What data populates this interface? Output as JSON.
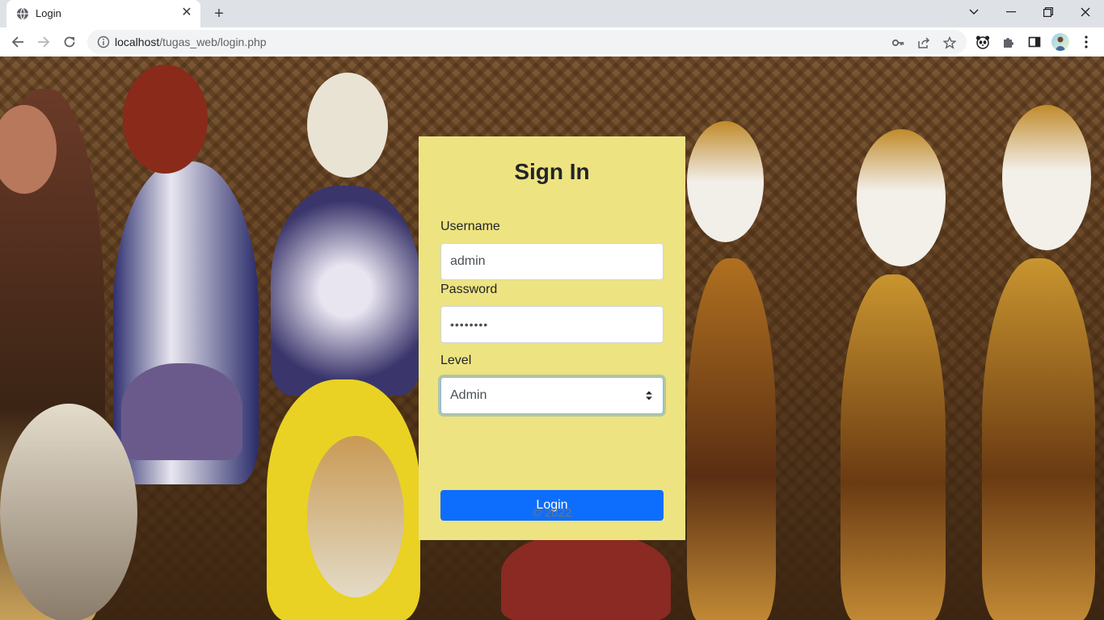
{
  "browser": {
    "tab_title": "Login",
    "url_host": "localhost",
    "url_path": "/tugas_web/login.php"
  },
  "card": {
    "title": "Sign In",
    "username_label": "Username",
    "username_value": "admin",
    "password_label": "Password",
    "password_value": "••••••••",
    "level_label": "Level",
    "level_selected": "Admin",
    "login_button": "Login",
    "footer": "© 2022"
  },
  "colors": {
    "card_bg": "#ede381",
    "button_bg": "#0d6efd"
  },
  "icons": [
    "globe-icon",
    "close-icon",
    "plus-icon",
    "chevron-down-icon",
    "minimize-icon",
    "restore-icon",
    "close-window-icon",
    "back-icon",
    "forward-icon",
    "reload-icon",
    "info-icon",
    "key-icon",
    "share-icon",
    "star-icon",
    "panda-extension-icon",
    "puzzle-icon",
    "side-panel-icon",
    "avatar",
    "menu-icon",
    "select-arrow-icon"
  ]
}
